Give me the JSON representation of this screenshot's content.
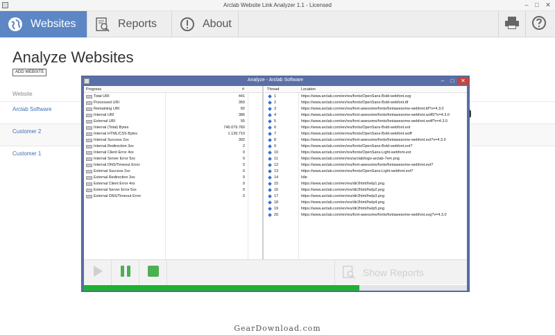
{
  "window": {
    "title": "Arclab Website Link Analyzer 1.1 - Licensed"
  },
  "toolbar": {
    "tabs": [
      {
        "label": "Websites",
        "icon": "globe-icon",
        "active": true
      },
      {
        "label": "Reports",
        "icon": "report-search-icon",
        "active": false
      },
      {
        "label": "About",
        "icon": "info-icon",
        "active": false
      }
    ],
    "right_icons": [
      "printer-icon",
      "help-icon"
    ]
  },
  "main": {
    "page_title": "Analyze Websites",
    "add_button": "ADD WEBSITE",
    "column_header": "Website",
    "websites": [
      "Arclab Software",
      "Customer 2",
      "Customer 1"
    ]
  },
  "dialog": {
    "title": "Analyze - Arclab Software",
    "left_headers": {
      "progress": "Progress",
      "count": "#"
    },
    "stats": [
      {
        "label": "Total URI",
        "value": "441"
      },
      {
        "label": "Processed URI",
        "value": "359"
      },
      {
        "label": "Remaining URI",
        "value": "82"
      },
      {
        "label": "Internal URI",
        "value": "386"
      },
      {
        "label": "External URI",
        "value": "55"
      },
      {
        "label": "Internal (Total) Bytes",
        "value": "745.079.760"
      },
      {
        "label": "Internal HTML/CSS Bytes",
        "value": "1.139.710"
      },
      {
        "label": "Internal Success 2xx",
        "value": "302"
      },
      {
        "label": "Internal Redirection 3xx",
        "value": "2"
      },
      {
        "label": "Internal Client Error 4xx",
        "value": "0"
      },
      {
        "label": "Internal Server Error 5xx",
        "value": "0"
      },
      {
        "label": "Internal DNS/Timeout Error",
        "value": "0"
      },
      {
        "label": "External Success 2xx",
        "value": "0"
      },
      {
        "label": "External Redirection 3xx",
        "value": "0"
      },
      {
        "label": "External Client Error 4xx",
        "value": "0"
      },
      {
        "label": "External Server Error 5xx",
        "value": "0"
      },
      {
        "label": "External DNS/Timeout Error",
        "value": "0"
      }
    ],
    "right_headers": {
      "thread": "Thread",
      "location": "Location"
    },
    "threads": [
      {
        "n": "1",
        "loc": "https://www.arclab.com/en/res/fonts/OpenSans-Bold-webfont.svg"
      },
      {
        "n": "2",
        "loc": "https://www.arclab.com/en/res/fonts/OpenSans-Bold-webfont.ttf"
      },
      {
        "n": "3",
        "loc": "https://www.arclab.com/en/res/font-awesome/fonts/fontawesome-webfont.ttf?v=4.3.0"
      },
      {
        "n": "4",
        "loc": "https://www.arclab.com/en/res/font-awesome/fonts/fontawesome-webfont.woff2?v=4.3.0"
      },
      {
        "n": "5",
        "loc": "https://www.arclab.com/en/res/font-awesome/fonts/fontawesome-webfont.woff?v=4.3.0"
      },
      {
        "n": "6",
        "loc": "https://www.arclab.com/en/res/fonts/OpenSans-Bold-webfont.eot"
      },
      {
        "n": "7",
        "loc": "https://www.arclab.com/en/res/fonts/OpenSans-Bold-webfont.woff"
      },
      {
        "n": "8",
        "loc": "https://www.arclab.com/en/res/font-awesome/fonts/fontawesome-webfont.eot?v=4.3.0"
      },
      {
        "n": "9",
        "loc": "https://www.arclab.com/en/res/fonts/OpenSans-Bold-webfont.eot?"
      },
      {
        "n": "10",
        "loc": "https://www.arclab.com/en/res/fonts/OpenSans-Light-webfont.eot"
      },
      {
        "n": "11",
        "loc": "https://www.arclab.com/en/res/arclab/logo-arclab-7em.png"
      },
      {
        "n": "12",
        "loc": "https://www.arclab.com/en/res/font-awesome/fonts/fontawesome-webfont.eot?"
      },
      {
        "n": "13",
        "loc": "https://www.arclab.com/en/res/fonts/OpenSans-Light-webfont.eot?"
      },
      {
        "n": "14",
        "loc": "Idle"
      },
      {
        "n": "15",
        "loc": "https://www.arclab.com/en/res/dir2html/help1.png"
      },
      {
        "n": "16",
        "loc": "https://www.arclab.com/en/res/dir2html/help2.png"
      },
      {
        "n": "17",
        "loc": "https://www.arclab.com/en/res/dir2html/help3.png"
      },
      {
        "n": "18",
        "loc": "https://www.arclab.com/en/res/dir2html/help4.png"
      },
      {
        "n": "19",
        "loc": "https://www.arclab.com/en/res/dir2html/help5.png"
      },
      {
        "n": "20",
        "loc": "https://www.arclab.com/en/res/font-awesome/fonts/fontawesome-webfont.svg?v=4.3.0"
      }
    ],
    "show_reports_label": "Show Reports",
    "progress_fraction": 0.72,
    "progress_color": "#1bb32e"
  },
  "colors": {
    "accent": "#5c86c4",
    "dialog_frame": "#5a6fa6",
    "link": "#3d6eb5",
    "stop": "#4caf50"
  },
  "watermark": "GearDownload.com"
}
